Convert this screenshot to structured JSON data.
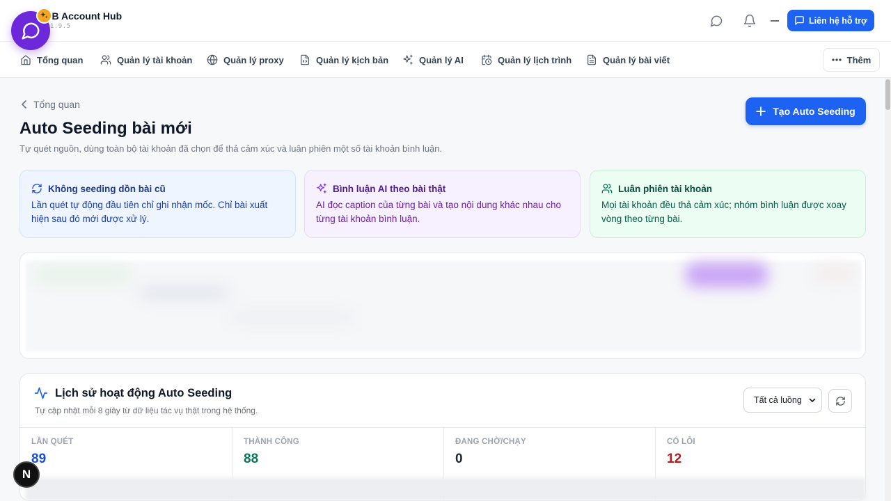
{
  "app": {
    "name": "FB Account Hub",
    "version": "v1.9.5",
    "support_label": "Liên hệ hỗ trợ"
  },
  "nav": {
    "items": [
      {
        "label": "Tổng quan",
        "icon": "home-icon"
      },
      {
        "label": "Quản lý tài khoản",
        "icon": "users-icon"
      },
      {
        "label": "Quản lý proxy",
        "icon": "globe-icon"
      },
      {
        "label": "Quản lý kịch bản",
        "icon": "file-code-icon"
      },
      {
        "label": "Quản lý AI",
        "icon": "sparkles-icon"
      },
      {
        "label": "Quản lý lịch trình",
        "icon": "calendar-clock-icon"
      },
      {
        "label": "Quản lý bài viết",
        "icon": "file-text-icon"
      }
    ],
    "more_label": "Thêm"
  },
  "page": {
    "breadcrumb": "Tổng quan",
    "title": "Auto Seeding bài mới",
    "subtitle": "Tự quét nguồn, dùng toàn bộ tài khoản đã chọn để thả cảm xúc và luân phiên một số tài khoản bình luận.",
    "create_label": "Tạo Auto Seeding"
  },
  "info_cards": [
    {
      "title": "Không seeding dồn bài cũ",
      "text": "Lần quét tự động đầu tiên chỉ ghi nhận mốc. Chỉ bài xuất hiện sau đó mới được xử lý.",
      "icon": "refresh-icon"
    },
    {
      "title": "Bình luận AI theo bài thật",
      "text": "AI đọc caption của từng bài và tạo nội dung khác nhau cho từng tài khoản bình luận.",
      "icon": "sparkles-icon"
    },
    {
      "title": "Luân phiên tài khoản",
      "text": "Mọi tài khoản đều thả cảm xúc; nhóm bình luận được xoay vòng theo từng bài.",
      "icon": "users-icon"
    }
  ],
  "history": {
    "title": "Lịch sử hoạt động Auto Seeding",
    "subtitle": "Tự cập nhật mỗi 8 giây từ dữ liệu tác vụ thật trong hệ thống.",
    "filter_value": "Tất cả luồng",
    "stats": [
      {
        "label": "Lần quét",
        "value": "89",
        "color": "#1d4ed8"
      },
      {
        "label": "Thành công",
        "value": "88",
        "color": "#047857"
      },
      {
        "label": "Đang chờ/chạy",
        "value": "0",
        "color": "#1f2937"
      },
      {
        "label": "Có lỗi",
        "value": "12",
        "color": "#b91c1c"
      }
    ]
  },
  "colors": {
    "primary": "#1d62f0",
    "chat_bubble": "#6d28d9"
  },
  "overlay": {
    "n_badge": "N"
  }
}
